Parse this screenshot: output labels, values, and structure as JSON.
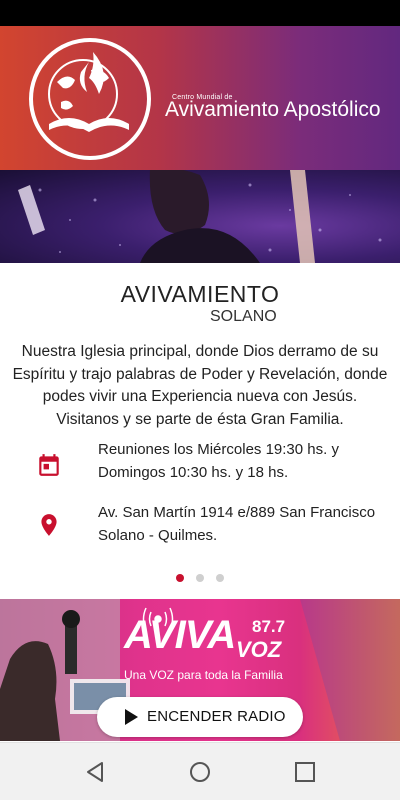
{
  "header": {
    "org_small": "Centro Mundial de",
    "org_name": "Avivamiento Apostólico"
  },
  "church": {
    "title": "AVIVAMIENTO",
    "subtitle": "SOLANO",
    "description": "Nuestra Iglesia principal, donde Dios derramo de su Espíritu y trajo palabras de Poder y Revelación, donde podes vivir una Experiencia nueva con Jesús. Visitanos y se parte de ésta Gran Familia."
  },
  "info": {
    "schedule": "Reuniones los Miércoles 19:30 hs. y Domingos 10:30 hs. y 18 hs.",
    "address": "Av. San Martín 1914 e/889 San Francisco Solano - Quilmes."
  },
  "carousel": {
    "pages": 3,
    "active_index": 0
  },
  "radio": {
    "logo": "AVIVA",
    "frequency": "87.7",
    "logo_sub": "VOZ",
    "tagline": "Una VOZ para toda la Familia",
    "button_label": "ENCENDER RADIO"
  },
  "colors": {
    "accent": "#c8102e",
    "header_gradient_start": "#d2452f",
    "header_gradient_end": "#62287f",
    "radio_pink": "#e0338c"
  },
  "icons": {
    "schedule": "calendar-icon",
    "address": "location-pin-icon",
    "play": "play-icon",
    "nav_back": "back-triangle-icon",
    "nav_home": "home-circle-icon",
    "nav_recents": "recents-square-icon"
  }
}
